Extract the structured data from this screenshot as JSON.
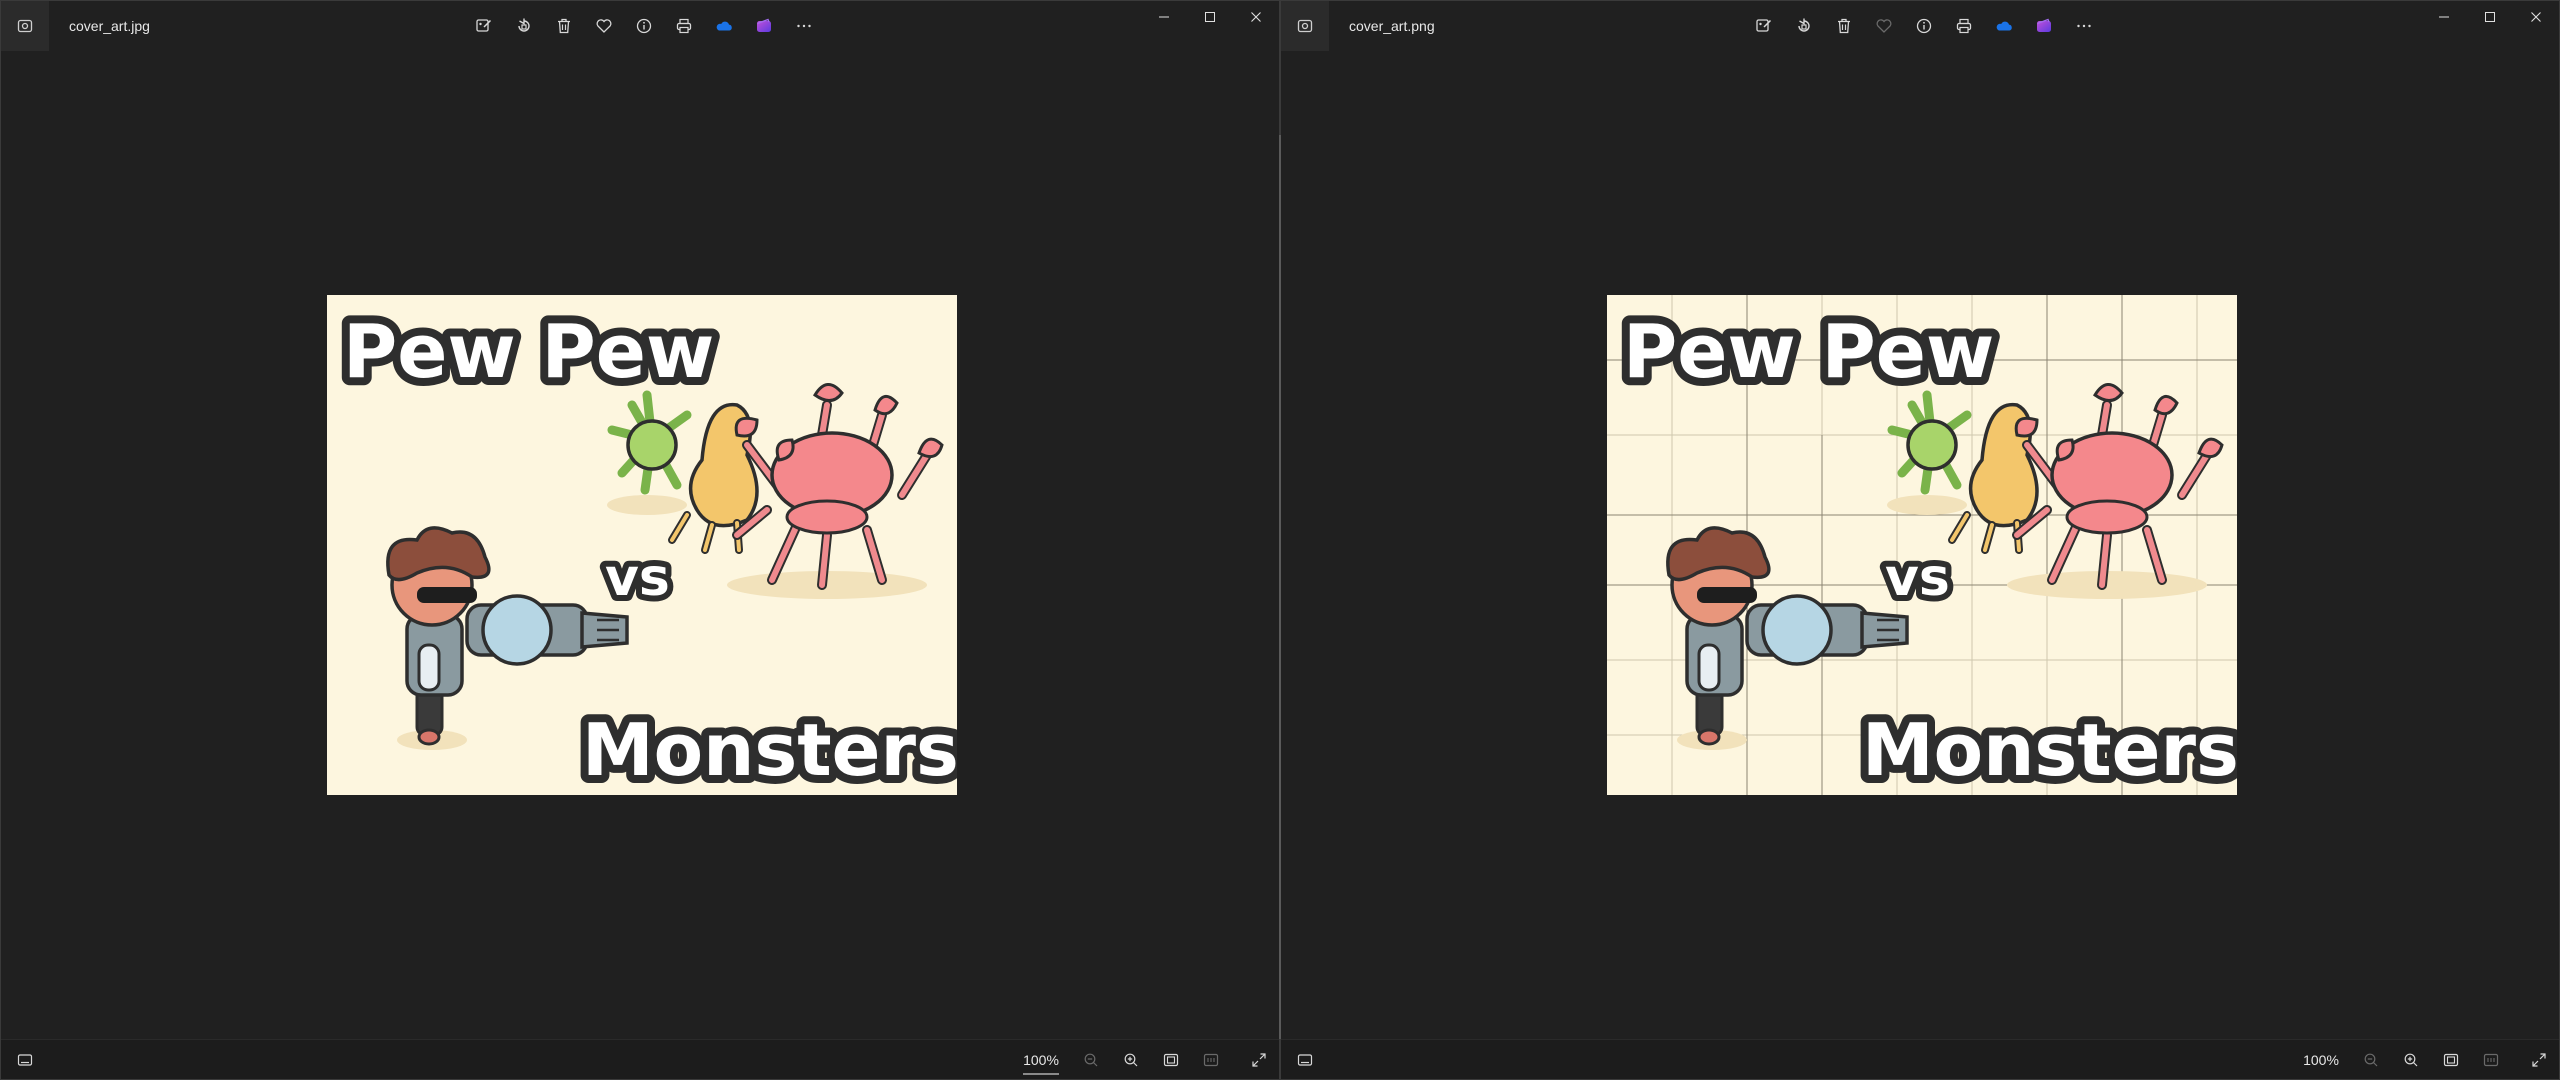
{
  "left": {
    "filename": "cover_art.jpg",
    "zoom": "100%",
    "favorite_enabled": true
  },
  "right": {
    "filename": "cover_art.png",
    "zoom": "100%",
    "favorite_enabled": false
  },
  "artwork": {
    "title_line1": "Pew Pew",
    "title_vs": "vs",
    "title_line2": "Monsters"
  },
  "toolbar_icons": [
    "edit-icon",
    "rotate-icon",
    "delete-icon",
    "favorite-icon",
    "info-icon",
    "print-icon",
    "onedrive-icon",
    "clipchamp-icon",
    "more-icon"
  ],
  "colors": {
    "background": "#202020",
    "art_bg": "#fdf6df",
    "onedrive": "#1a73e8",
    "clipchamp": "#7b3fe4"
  }
}
